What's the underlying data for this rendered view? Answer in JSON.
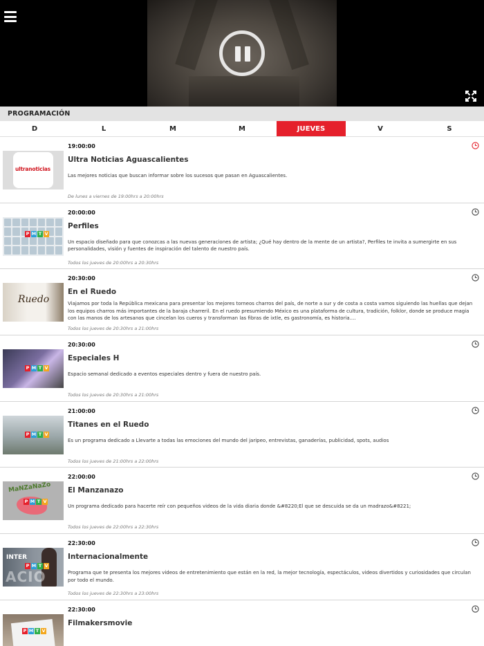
{
  "section_title": "PROGRAMACIÓN",
  "days": [
    {
      "label": "D",
      "active": false
    },
    {
      "label": "L",
      "active": false
    },
    {
      "label": "M",
      "active": false
    },
    {
      "label": "M",
      "active": false
    },
    {
      "label": "JUEVES",
      "active": true
    },
    {
      "label": "V",
      "active": false
    },
    {
      "label": "S",
      "active": false
    }
  ],
  "colors": {
    "accent": "#e5202b",
    "clock_active": "#e5202b",
    "clock": "#444444"
  },
  "icons": {
    "menu": "hamburger-icon",
    "pause": "pause-icon",
    "fullscreen": "fullscreen-icon",
    "clock": "clock-icon"
  },
  "thumb_text": {
    "ultra": "ultranoticias",
    "pmtv": [
      "P",
      "M",
      "T",
      "V"
    ],
    "ruedo": "Ruedo",
    "manz": "MaNZaNaZo",
    "inter_top": "INTER",
    "inter_bottom": "ACIO"
  },
  "programs": [
    {
      "time": "19:00:00",
      "title": "Ultra Noticias Aguascalientes",
      "description": "Las mejores noticias que buscan informar sobre los sucesos que pasan en Aguascalientes.",
      "schedule": "De lunes a viernes de 19:00hrs a 20:00hrs",
      "highlight": true
    },
    {
      "time": "20:00:00",
      "title": "Perfiles",
      "description": "Un espacio diseñado para que conozcas a las nuevas generaciones de artista; ¿Qué hay dentro de la mente de un artista?, Perfiles te invita a sumergirte en sus personalidades, visión y fuentes de inspiración del talento de nuestro país.",
      "schedule": "Todos los jueves de 20:00hrs a 20:30hrs",
      "highlight": false
    },
    {
      "time": "20:30:00",
      "title": "En el Ruedo",
      "description": "Viajamos por toda la República mexicana para presentar los mejores torneos charros del país, de norte a sur y de costa a costa vamos siguiendo las huellas que dejan los equipos charros más importantes de la baraja charreril. En el ruedo presumiendo México es una plataforma de cultura, tradición, folklor, donde se produce magia con las manos de los artesanos que cincelan los cueros y transforman las fibras de ixtle, es gastronomía, es historia....",
      "schedule": "Todos los jueves de 20:30hrs a 21:00hrs",
      "highlight": false
    },
    {
      "time": "20:30:00",
      "title": "Especiales H",
      "description": "Espacio semanal dedicado a eventos especiales dentro y fuera de nuestro país.",
      "schedule": "Todos los jueves de 20:30hrs a 21:00hrs",
      "highlight": false
    },
    {
      "time": "21:00:00",
      "title": "Titanes en el Ruedo",
      "description": "Es un programa dedicado a Llevarte a todas las emociones del mundo del jaripeo, entrevistas, ganaderías, publicidad, spots, audios",
      "schedule": "Todos los jueves de 21:00hrs a 22:00hrs",
      "highlight": false
    },
    {
      "time": "22:00:00",
      "title": "El Manzanazo",
      "description": "Un programa dedicado para hacerte reír con pequeños videos de la vida diaria donde &#8220;El que se descuida se da un madrazo&#8221;",
      "schedule": "Todos los jueves de 22:00hrs a 22:30hrs",
      "highlight": false
    },
    {
      "time": "22:30:00",
      "title": "Internacionalmente",
      "description": "Programa que te presenta los mejores videos de entretenimiento que están en la red, la mejor tecnología, espectáculos, videos divertidos y curiosidades que circulan por todo el mundo.",
      "schedule": "Todos los jueves de 22:30hrs a 23:00hrs",
      "highlight": false
    },
    {
      "time": "22:30:00",
      "title": "Filmakersmovie",
      "description": "",
      "schedule": "",
      "highlight": false
    }
  ]
}
